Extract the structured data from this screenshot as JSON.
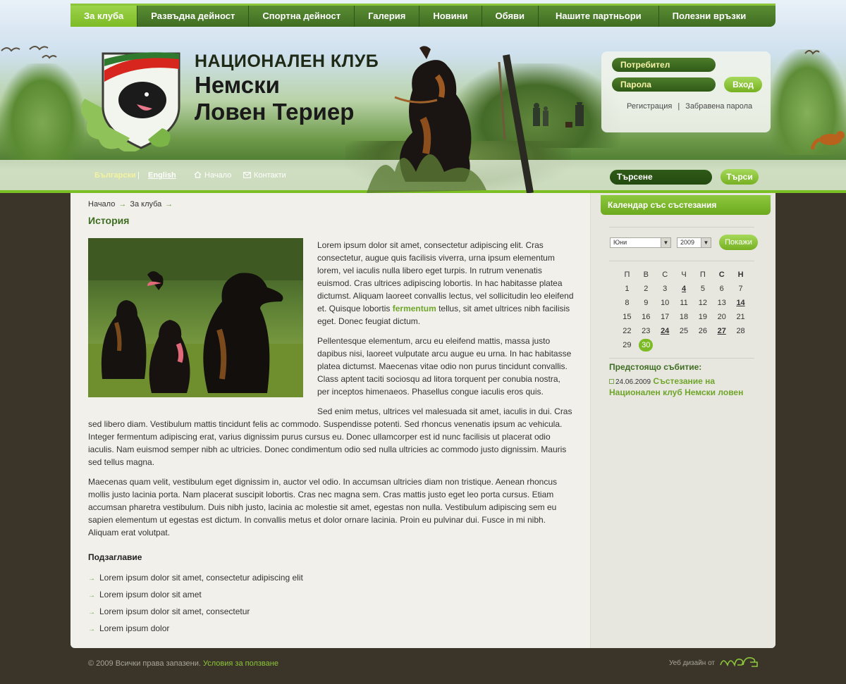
{
  "nav": {
    "items": [
      "За клуба",
      "Развъдна дейност",
      "Спортна дейност",
      "Галерия",
      "Новини",
      "Обяви",
      "Нашите партньори",
      "Полезни връзки"
    ],
    "active_index": 0
  },
  "brand": {
    "line1": "НАЦИОНАЛЕН КЛУБ",
    "line2": "Немски",
    "line3": "Ловен Териер"
  },
  "login": {
    "user_placeholder": "Потребител",
    "password_placeholder": "Парола",
    "button": "Вход",
    "register": "Регистрация",
    "separator": "|",
    "forgot": "Забравена парола"
  },
  "subnav": {
    "lang_bg": "Български",
    "lang_sep": "|",
    "lang_en": "English",
    "home": "Начало",
    "contacts": "Контакти"
  },
  "search": {
    "placeholder": "Търсене",
    "button": "Търси"
  },
  "breadcrumb": [
    "Начало",
    "За клуба"
  ],
  "main": {
    "title": "История",
    "p1_before": "Lorem ipsum dolor sit amet, consectetur adipiscing elit. Cras consectetur, augue quis facilisis viverra, urna ipsum elementum lorem, vel iaculis nulla libero eget turpis. In rutrum venenatis euismod. Cras ultrices adipiscing lobortis. In hac habitasse platea dictumst. Aliquam laoreet convallis lectus, vel sollicitudin leo eleifend et. Quisque lobortis ",
    "p1_highlight": "fermentum",
    "p1_after": " tellus, sit amet ultrices nibh facilisis eget. Donec feugiat dictum.",
    "p2": "Pellentesque elementum, arcu eu eleifend mattis, massa justo dapibus nisi, laoreet vulputate arcu augue eu urna. In hac habitasse platea dictumst. Maecenas vitae odio non purus tincidunt convallis. Class aptent taciti sociosqu ad litora torquent per conubia nostra, per inceptos himenaeos. Phasellus congue iaculis eros quis.",
    "p3": "Sed enim metus, ultrices vel malesuada sit amet, iaculis in dui. Cras sed libero diam. Vestibulum mattis tincidunt felis ac commodo. Suspendisse potenti. Sed rhoncus venenatis ipsum ac vehicula. Integer fermentum adipiscing erat, varius dignissim purus cursus eu. Donec ullamcorper est id nunc facilisis ut placerat odio iaculis. Nam euismod semper nibh ac ultricies. Donec condimentum odio sed nulla ultricies ac commodo justo dignissim. Mauris sed tellus magna.",
    "p4": "Maecenas quam velit, vestibulum eget dignissim in, auctor vel odio. In accumsan ultricies diam non tristique. Aenean rhoncus mollis justo lacinia porta. Nam placerat suscipit lobortis. Cras nec magna sem. Cras mattis justo eget leo porta cursus. Etiam accumsan pharetra vestibulum. Duis nibh justo, lacinia ac molestie sit amet, egestas non nulla. Vestibulum adipiscing sem eu sapien elementum ut egestas est dictum. In convallis metus et dolor ornare lacinia. Proin eu pulvinar dui. Fusce in mi nibh. Aliquam erat volutpat.",
    "subheading": "Подзаглавие",
    "bullets": [
      "Lorem ipsum dolor sit amet, consectetur adipiscing elit",
      "Lorem ipsum dolor sit amet",
      "Lorem ipsum dolor sit amet, consectetur",
      "Lorem ipsum dolor"
    ]
  },
  "calendar": {
    "title": "Календар със състезания",
    "month": "Юни",
    "year": "2009",
    "show_button": "Покажи",
    "weekdays": [
      "П",
      "В",
      "С",
      "Ч",
      "П",
      "С",
      "Н"
    ],
    "weeks": [
      [
        "1",
        "2",
        "3",
        "4",
        "5",
        "6",
        "7"
      ],
      [
        "8",
        "9",
        "10",
        "11",
        "12",
        "13",
        "14"
      ],
      [
        "15",
        "16",
        "17",
        "18",
        "19",
        "20",
        "21"
      ],
      [
        "22",
        "23",
        "24",
        "25",
        "26",
        "27",
        "28"
      ],
      [
        "29",
        "30",
        "",
        "",
        "",
        "",
        ""
      ]
    ],
    "event_days": [
      "4",
      "14",
      "24",
      "27"
    ],
    "today": "30",
    "upcoming_label": "Предстоящо събитие:",
    "event_date": "24.06.2009",
    "event_name": "Състезание на Национален клуб Немски ловен"
  },
  "footer": {
    "copyright": "© 2009 Всички права запазени.",
    "terms": "Условия за ползване",
    "design_by": "Уеб дизайн  от"
  },
  "colors": {
    "accent_green": "#7dbb26",
    "dark_green": "#3d6d21",
    "page_bg": "#3a3528"
  }
}
